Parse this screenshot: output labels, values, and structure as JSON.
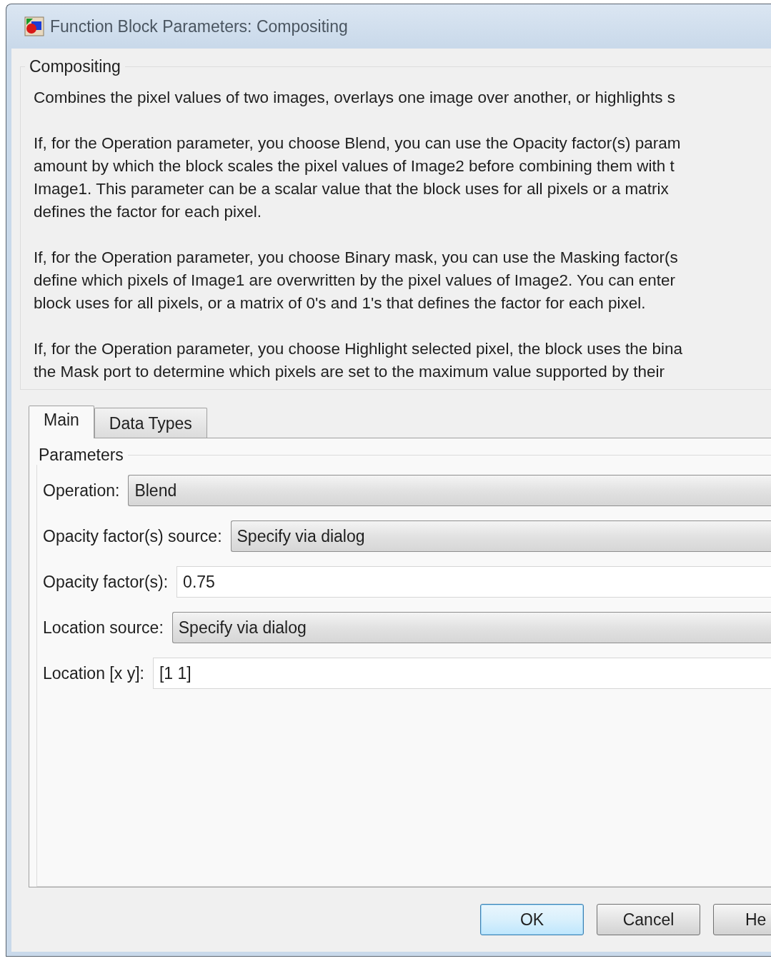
{
  "window": {
    "title": "Function Block Parameters: Compositing"
  },
  "description": {
    "title": "Compositing",
    "paragraphs": [
      [
        "Combines the pixel values of two images, overlays one image over another, or highlights s"
      ],
      [
        "If, for the Operation parameter, you choose Blend, you can use the Opacity factor(s) param",
        "amount by which the block scales the pixel values of Image2 before combining them with t",
        "Image1. This parameter can be a scalar value that the block uses for all pixels or a matrix",
        "defines the factor for each pixel."
      ],
      [
        "If, for the Operation parameter, you choose Binary mask, you can use the Masking factor(s",
        "define which pixels of Image1 are overwritten by the pixel values of Image2. You can enter",
        "block uses for all pixels, or a matrix of 0's and 1's that defines the factor for each pixel."
      ],
      [
        "If, for the Operation parameter, you choose Highlight selected pixel, the block uses the bina",
        "the Mask port to determine which pixels are set to the maximum value supported by their"
      ]
    ]
  },
  "tabs": [
    {
      "label": "Main",
      "selected": true
    },
    {
      "label": "Data Types",
      "selected": false
    }
  ],
  "parameters": {
    "title": "Parameters",
    "rows": [
      {
        "kind": "dropdown",
        "label": "Operation:",
        "value": "Blend"
      },
      {
        "kind": "dropdown",
        "label": "Opacity factor(s) source:",
        "value": "Specify via dialog"
      },
      {
        "kind": "text",
        "label": "Opacity factor(s):",
        "value": "0.75"
      },
      {
        "kind": "dropdown",
        "label": "Location source:",
        "value": "Specify via dialog"
      },
      {
        "kind": "text",
        "label": "Location [x y]:",
        "value": "[1 1]"
      }
    ]
  },
  "buttons": [
    {
      "label": "OK",
      "default": true
    },
    {
      "label": "Cancel",
      "default": false
    },
    {
      "label": "He",
      "default": false
    }
  ]
}
